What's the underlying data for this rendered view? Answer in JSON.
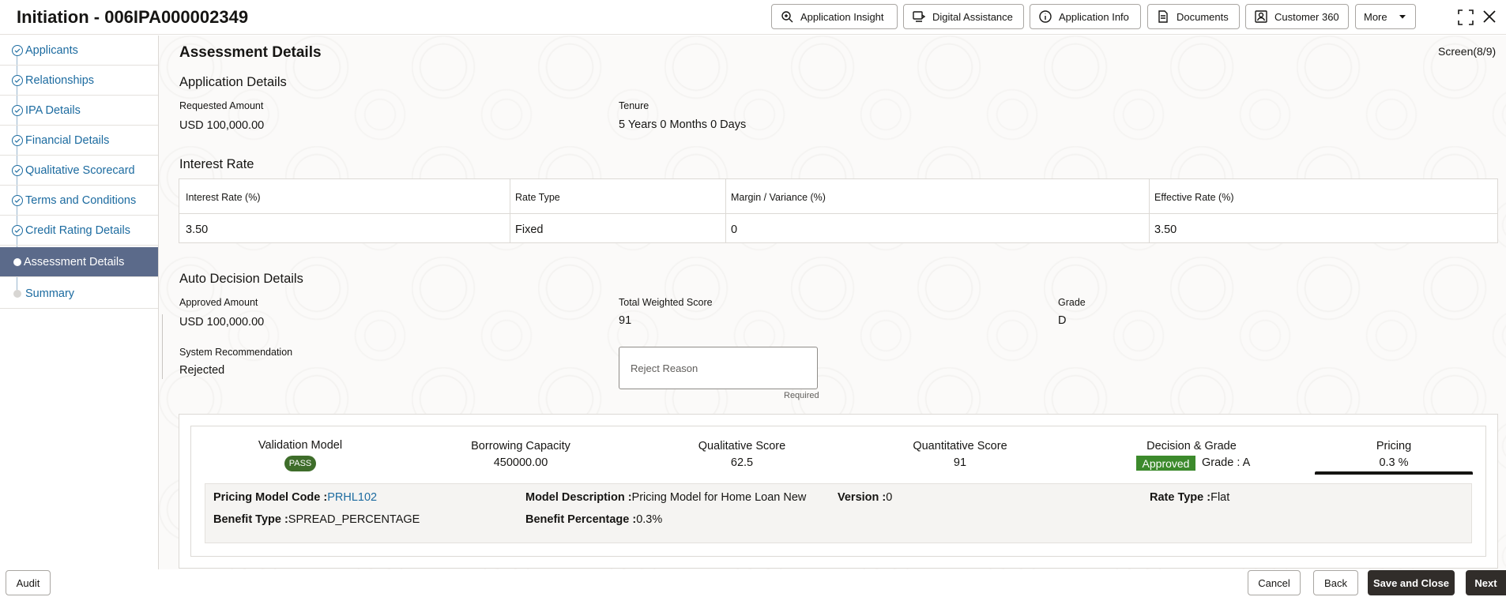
{
  "header": {
    "title": "Initiation - 006IPA000002349",
    "buttons": {
      "application_insight": "Application Insight",
      "digital_assistance": "Digital Assistance",
      "application_info": "Application Info",
      "documents": "Documents",
      "customer_360": "Customer 360",
      "more": "More"
    }
  },
  "sidebar": {
    "items": [
      {
        "label": "Applicants",
        "state": "done"
      },
      {
        "label": "Relationships",
        "state": "done"
      },
      {
        "label": "IPA Details",
        "state": "done"
      },
      {
        "label": "Financial Details",
        "state": "done"
      },
      {
        "label": "Qualitative Scorecard",
        "state": "done"
      },
      {
        "label": "Terms and Conditions",
        "state": "done"
      },
      {
        "label": "Credit Rating Details",
        "state": "done"
      },
      {
        "label": "Assessment Details",
        "state": "active"
      },
      {
        "label": "Summary",
        "state": "pending"
      }
    ]
  },
  "page": {
    "title": "Assessment Details",
    "screen_indicator": "Screen(8/9)"
  },
  "application_details": {
    "heading": "Application Details",
    "requested_amount_label": "Requested Amount",
    "requested_amount_value": "USD 100,000.00",
    "tenure_label": "Tenure",
    "tenure_value": "5 Years 0 Months 0 Days"
  },
  "interest_rate": {
    "heading": "Interest Rate",
    "columns": [
      "Interest Rate (%)",
      "Rate Type",
      "Margin / Variance (%)",
      "Effective Rate (%)"
    ],
    "row": [
      "3.50",
      "Fixed",
      "0",
      "3.50"
    ]
  },
  "auto_decision": {
    "heading": "Auto Decision Details",
    "approved_amount_label": "Approved Amount",
    "approved_amount_value": "USD 100,000.00",
    "total_weighted_score_label": "Total Weighted Score",
    "total_weighted_score_value": "91",
    "grade_label": "Grade",
    "grade_value": "D",
    "system_recommendation_label": "System Recommendation",
    "system_recommendation_value": "Rejected",
    "reject_reason_placeholder": "Reject Reason",
    "reject_reason_value": "",
    "required_text": "Required"
  },
  "summary_card": {
    "validation_model_title": "Validation Model",
    "validation_model_badge": "PASS",
    "borrowing_capacity_title": "Borrowing Capacity",
    "borrowing_capacity_value": "450000.00",
    "qualitative_score_title": "Qualitative Score",
    "qualitative_score_value": "62.5",
    "quantitative_score_title": "Quantitative Score",
    "quantitative_score_value": "91",
    "decision_grade_title": "Decision & Grade",
    "decision_badge": "Approved",
    "decision_grade_value": "Grade : A",
    "pricing_title": "Pricing",
    "pricing_value": "0.3 %"
  },
  "pricing_details": {
    "pricing_model_code_label": "Pricing Model Code :",
    "pricing_model_code_value": "PRHL102",
    "model_description_label": "Model Description :",
    "model_description_value": "Pricing Model for Home Loan New",
    "version_label": "Version :",
    "version_value": "0",
    "rate_type_label": "Rate Type :",
    "rate_type_value": "Flat",
    "benefit_type_label": "Benefit Type :",
    "benefit_type_value": "SPREAD_PERCENTAGE",
    "benefit_percentage_label": "Benefit Percentage :",
    "benefit_percentage_value": "0.3%"
  },
  "footer": {
    "audit": "Audit",
    "cancel": "Cancel",
    "back": "Back",
    "save_and_close": "Save and Close",
    "next": "Next"
  },
  "colors": {
    "link": "#1c6ba0",
    "active_nav": "#5b6a8a",
    "pass_badge": "#3e6d2a",
    "approved_badge": "#3c8a2c",
    "primary_button": "#312d2a"
  }
}
